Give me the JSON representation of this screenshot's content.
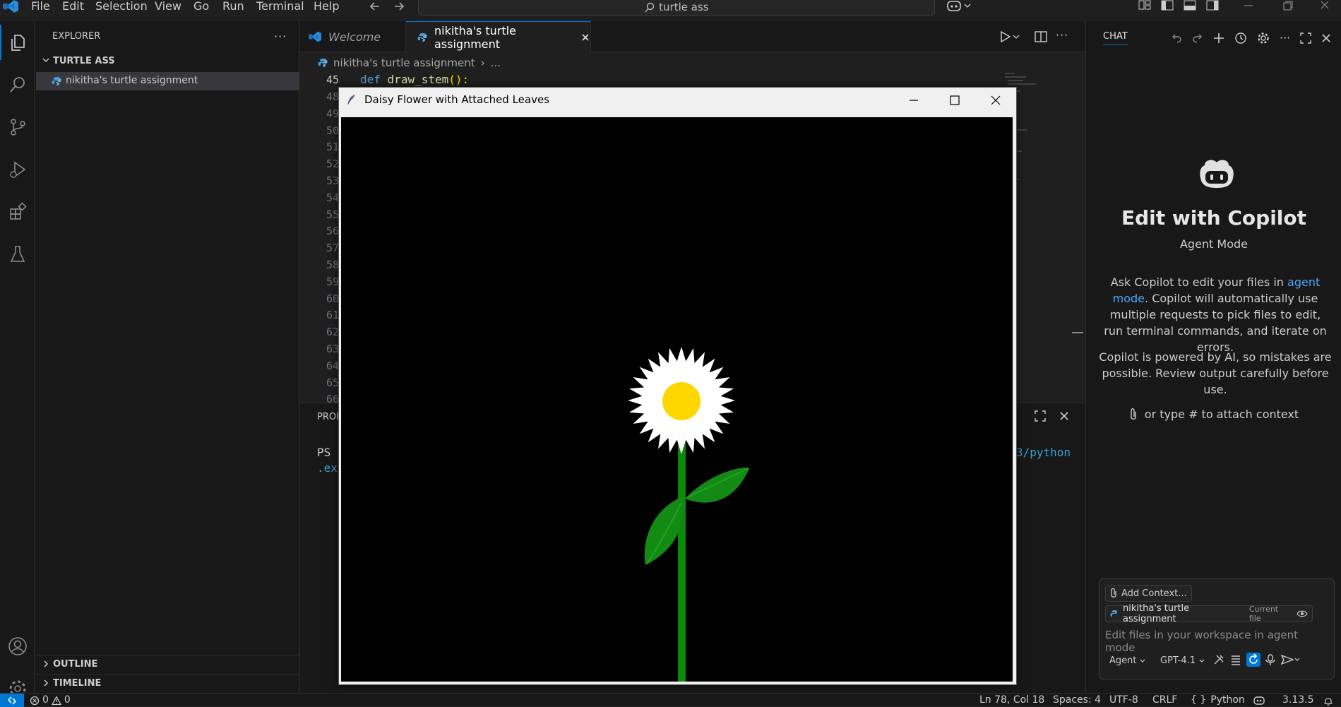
{
  "menu": [
    "File",
    "Edit",
    "Selection",
    "View",
    "Go",
    "Run",
    "Terminal",
    "Help"
  ],
  "search": {
    "text": "turtle ass"
  },
  "sidebar": {
    "title": "EXPLORER",
    "folder": "TURTLE ASS",
    "file": "nikitha's turtle assignment",
    "outline": "OUTLINE",
    "timeline": "TIMELINE"
  },
  "tabs": [
    {
      "label": "Welcome"
    },
    {
      "label": "nikitha's turtle assignment"
    }
  ],
  "breadcrumb": {
    "file": "nikitha's turtle assignment",
    "more": "..."
  },
  "code": {
    "first_line_num": "45",
    "first_line_kw": "def",
    "first_line_fn": "draw_stem",
    "first_line_rest": "():",
    "line_numbers": [
      "48",
      "49",
      "50",
      "51",
      "52",
      "53",
      "54",
      "55",
      "56",
      "57",
      "58",
      "59",
      "60",
      "61",
      "62",
      "63",
      "64",
      "65",
      "66"
    ]
  },
  "panel": {
    "tab": "PROE",
    "prompt": "PS",
    "line2": ".ex",
    "right_text": "3/python"
  },
  "turtle_window": {
    "title": "Daisy Flower with Attached Leaves"
  },
  "chat": {
    "header": "CHAT",
    "title": "Edit with Copilot",
    "mode": "Agent Mode",
    "desc_before": "Ask Copilot to edit your files in ",
    "desc_link": "agent mode",
    "desc_after": ". Copilot will automatically use multiple requests to pick files to edit, run terminal commands, and iterate on errors.",
    "disclaimer": "Copilot is powered by AI, so mistakes are possible. Review output carefully before use.",
    "attach_hint": "or type # to attach context",
    "add_context": "Add Context...",
    "context_file": "nikitha's turtle assignment",
    "context_tag": "Current file",
    "placeholder": "Edit files in your workspace in agent mode",
    "agent_label": "Agent",
    "model_label": "GPT-4.1"
  },
  "status": {
    "errors": "0",
    "warnings": "0",
    "position": "Ln 78, Col 18",
    "spaces": "Spaces: 4",
    "encoding": "UTF-8",
    "eol": "CRLF",
    "language": "Python",
    "version": "3.13.5"
  },
  "colors": {
    "accent": "#0078d4",
    "link": "#4daafc",
    "keyword": "#569cd6",
    "function": "#dcdcaa"
  }
}
